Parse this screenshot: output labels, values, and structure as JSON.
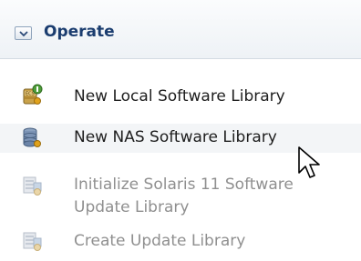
{
  "section": {
    "title": "Operate",
    "toggle_icon": "chevron-down-icon"
  },
  "items": [
    {
      "label": "New Local Software Library",
      "icon": "local-library-icon",
      "enabled": true
    },
    {
      "label": "New NAS Software Library",
      "icon": "nas-library-icon",
      "enabled": true
    },
    {
      "label_lines": [
        "Initialize Solaris 11 Software",
        "Update Library"
      ],
      "icon": "update-library-icon",
      "enabled": false
    },
    {
      "label": "Create Update Library",
      "icon": "create-library-icon",
      "enabled": false
    }
  ],
  "colors": {
    "header_text": "#1b3d6f",
    "enabled_text": "#1e1e1e",
    "disabled_text": "#8f8f8f",
    "hover_row": "#f3f5f7"
  }
}
